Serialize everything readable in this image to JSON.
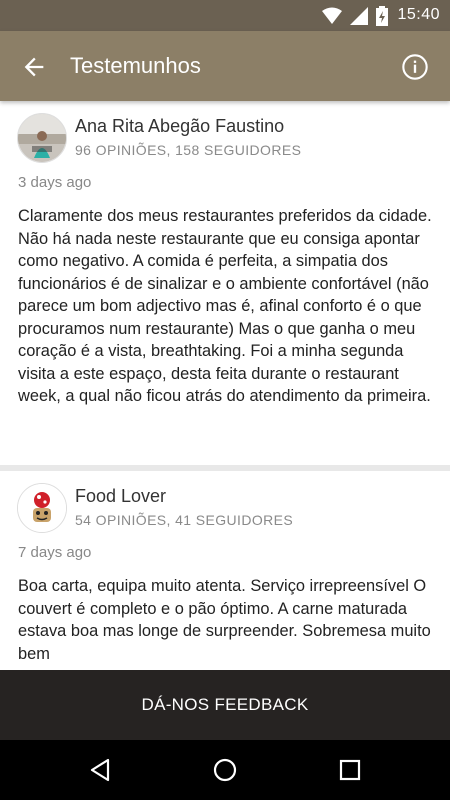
{
  "status_bar": {
    "time": "15:40"
  },
  "app_bar": {
    "title": "Testemunhos"
  },
  "reviews": [
    {
      "name": "Ana Rita Abegão Faustino",
      "stats": "96 OPINIÕES, 158 SEGUIDORES",
      "date": "3 days ago",
      "text": "Claramente dos meus restaurantes preferidos da cidade. Não há nada neste restaurante que eu consiga apontar como negativo. A comida é perfeita, a simpatia dos funcionários é de sinalizar e o ambiente confortável (não parece um bom adjectivo mas é, afinal conforto é o que procuramos num restaurante) Mas o que ganha o meu coração é a vista, breathtaking. Foi a minha segunda visita a este espaço, desta feita durante o restaurant week, a qual não ficou atrás do atendimento da primeira."
    },
    {
      "name": "Food Lover",
      "stats": "54 OPINIÕES, 41 SEGUIDORES",
      "date": "7 days ago",
      "text": "Boa carta, equipa muito atenta. Serviço irrepreensível O couvert é completo e o pão óptimo. A carne maturada estava boa mas longe de surpreender. Sobremesa muito bem"
    }
  ],
  "feedback_button": {
    "label": "DÁ-NOS FEEDBACK"
  },
  "colors": {
    "status_bar": "#6b6152",
    "app_bar": "#8c7f67",
    "feedback_bar": "#262322"
  }
}
